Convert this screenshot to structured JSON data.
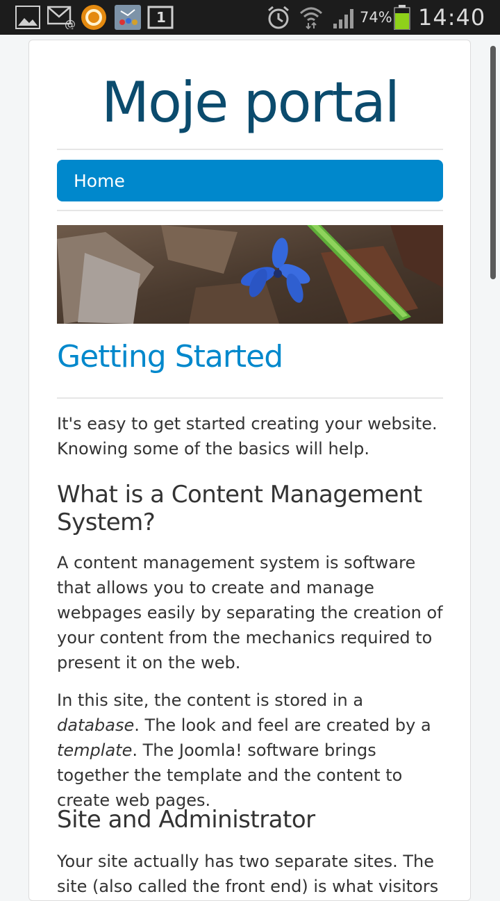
{
  "status_bar": {
    "battery_percent": "74%",
    "time": "14:40",
    "notification_count": "1",
    "icons": [
      "gallery-icon",
      "email-icon",
      "orange-ring-app-icon",
      "app-icon",
      "calendar-icon",
      "alarm-icon",
      "wifi-icon",
      "signal-icon",
      "battery-icon"
    ]
  },
  "site": {
    "brand": "Moje portal",
    "nav": {
      "home_label": "Home"
    },
    "banner_alt": "",
    "article": {
      "title": "Getting Started",
      "intro": "It's easy to get started creating your website. Knowing some of the basics will help.",
      "h2_cms": "What is a Content Management System?",
      "p_cms": "A content management system is software that allows you to create and manage webpages easily by separating the creation of your content from the mechanics required to present it on the web.",
      "p_db_1": "In this site, the content is stored in a ",
      "p_db_em1": "database",
      "p_db_2": ". The look and feel are created by a ",
      "p_db_em2": "template",
      "p_db_3": ". The Joomla! software brings together the template and the content to create web pages.",
      "h2_site": "Site and Administrator",
      "p_site": "Your site actually has two separate sites. The site (also called the front end) is what visitors"
    }
  },
  "colors": {
    "brand": "#0b4b6d",
    "accent": "#0088cc",
    "text": "#333333",
    "statusbar": "#1c1c1c",
    "battery": "#8fd11a"
  }
}
